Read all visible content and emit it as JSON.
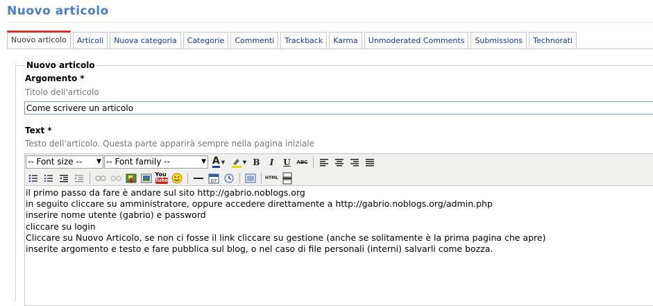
{
  "page": {
    "title": "Nuovo articolo"
  },
  "tabs": [
    {
      "label": "Nuovo articolo",
      "active": true
    },
    {
      "label": "Articoli"
    },
    {
      "label": "Nuova categoria"
    },
    {
      "label": "Categorie"
    },
    {
      "label": "Commenti"
    },
    {
      "label": "Trackback"
    },
    {
      "label": "Karma"
    },
    {
      "label": "Unmoderated Comments"
    },
    {
      "label": "Submissions"
    },
    {
      "label": "Technorati"
    }
  ],
  "form": {
    "legend": "Nuovo articolo",
    "subject_label": "Argomento *",
    "subject_help": "Titolo dell'articolo",
    "subject_value": "Come scrivere un articolo",
    "text_label": "Text *",
    "text_help": "Testo dell'articolo. Questa parte apparirà sempre nella pagina iniziale"
  },
  "toolbar": {
    "font_size": "-- Font size --",
    "font_family": "-- Font family --",
    "bold": "B",
    "italic": "I",
    "underline": "U",
    "strike": "ABC",
    "youtube": "You",
    "html": "HTML"
  },
  "editor": {
    "lines": [
      "il primo passo da fare è andare sul sito http://gabrio.noblogs.org",
      "in seguito cliccare su amministratore, oppure accedere direttamente a http://gabrio.noblogs.org/admin.php",
      "inserire nome utente (gabrio) e password",
      "cliccare su login",
      "Cliccare su Nuovo Articolo, se non ci fosse il link cliccare su gestione (anche se solitamente è la prima pagina che apre)",
      "inserite argomento e testo e fare pubblica sul blog, o nel caso di file personali (interni) salvarli come bozza."
    ]
  },
  "colors": {
    "title": "#4a7fc1",
    "tab_link": "#1a3c8c",
    "active_tab_accent": "#d9302c"
  }
}
